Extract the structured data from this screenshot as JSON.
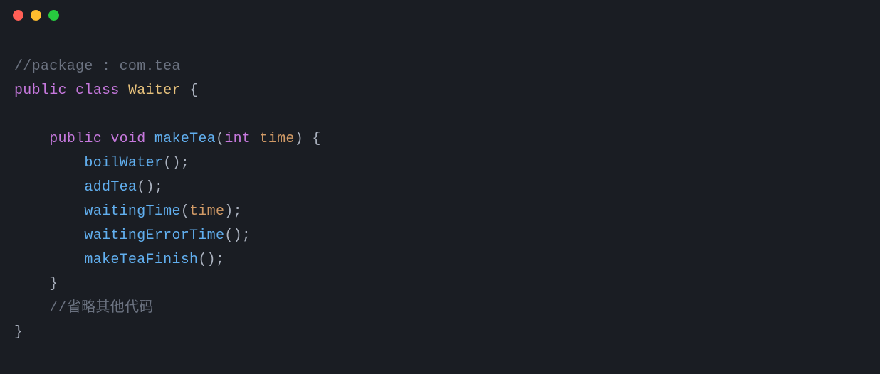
{
  "titlebar": {
    "buttons": [
      "close",
      "minimize",
      "maximize"
    ]
  },
  "code": {
    "line1_comment": "//package : com.tea",
    "line2_public": "public",
    "line2_class": "class",
    "line2_classname": "Waiter",
    "line2_openbrace": " {",
    "line4_public": "public",
    "line4_void": "void",
    "line4_method": "makeTea",
    "line4_paren_open": "(",
    "line4_param_type": "int",
    "line4_param_name": "time",
    "line4_paren_close": ")",
    "line4_openbrace": " {",
    "line5_call": "boilWater",
    "line5_parens": "();",
    "line6_call": "addTea",
    "line6_parens": "();",
    "line7_call": "waitingTime",
    "line7_paren_open": "(",
    "line7_arg": "time",
    "line7_paren_close": ");",
    "line8_call": "waitingErrorTime",
    "line8_parens": "();",
    "line9_call": "makeTeaFinish",
    "line9_parens": "();",
    "line10_closebrace": "}",
    "line11_comment": "//省略其他代码",
    "line12_closebrace": "}"
  }
}
